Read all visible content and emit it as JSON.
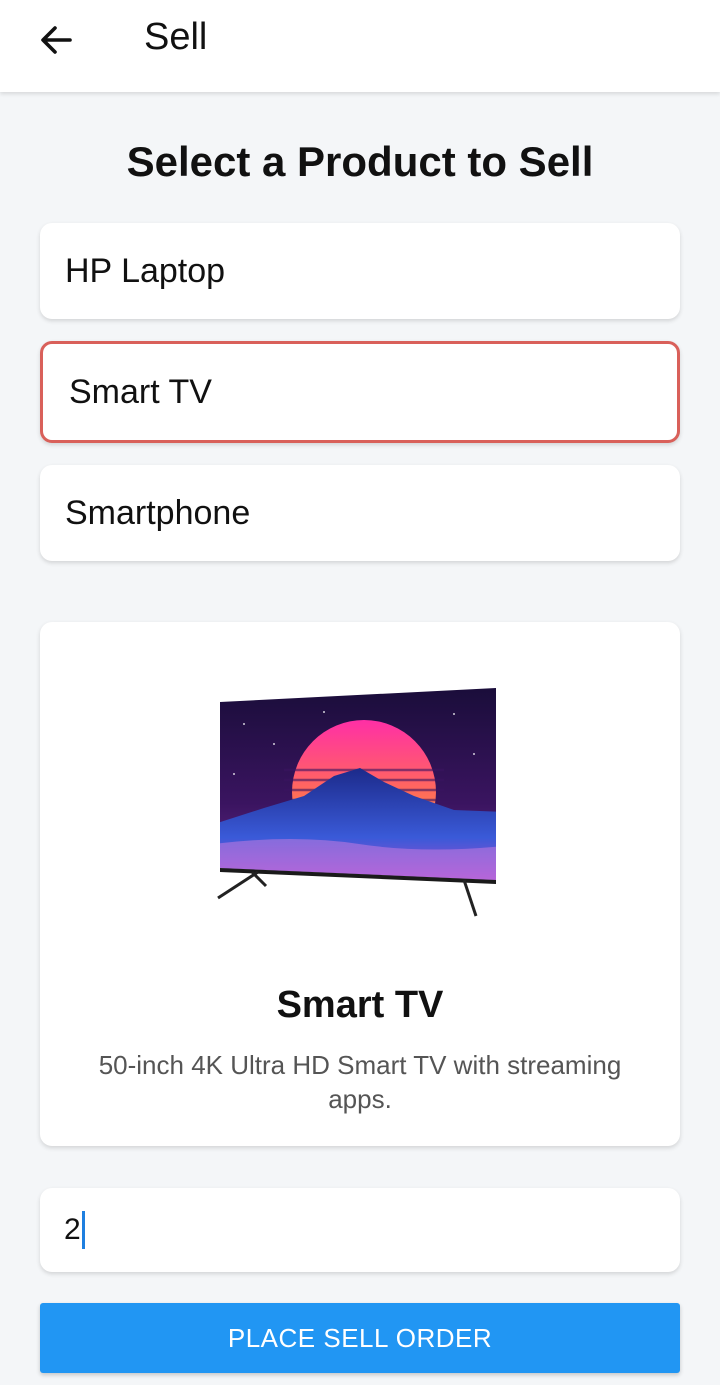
{
  "app_bar": {
    "title": "Sell",
    "back_icon": "arrow-left-icon"
  },
  "heading": "Select a Product to Sell",
  "products": [
    {
      "label": "HP Laptop",
      "selected": false
    },
    {
      "label": "Smart TV",
      "selected": true
    },
    {
      "label": "Smartphone",
      "selected": false
    }
  ],
  "detail": {
    "image": "smart-tv-image",
    "name": "Smart TV",
    "description": "50-inch 4K Ultra HD Smart TV with streaming apps."
  },
  "quantity": {
    "value": "2"
  },
  "sell_button": {
    "label": "PLACE SELL ORDER"
  },
  "colors": {
    "primary": "#2196f3",
    "selected_border": "#d9605a",
    "background": "#f4f6f8"
  }
}
